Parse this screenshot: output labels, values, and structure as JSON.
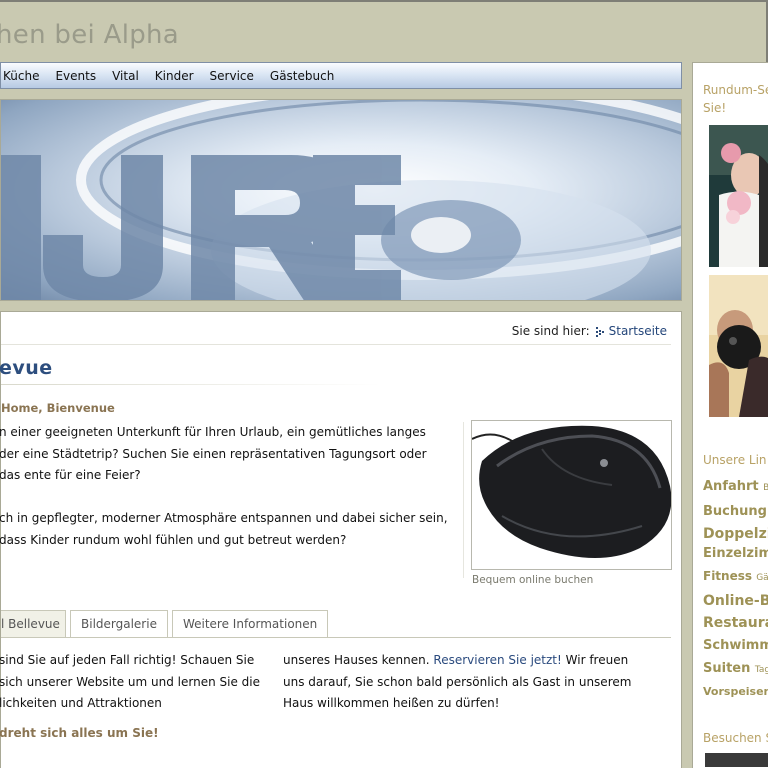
{
  "header": {
    "site_title": "hen bei Alpha"
  },
  "nav": {
    "items": [
      "Küche",
      "Events",
      "Vital",
      "Kinder",
      "Service",
      "Gästebuch"
    ]
  },
  "breadcrumb": {
    "label": "Sie sind hier:",
    "link": "Startseite"
  },
  "main": {
    "title": "evue",
    "subtitle": "Home, Bienvenue",
    "paragraph1": "n einer geeigneten Unterkunft für Ihren Urlaub, ein gemütliches langes der eine Städtetrip? Suchen Sie einen repräsentativen Tagungsort oder das ente für eine Feier?",
    "paragraph2": "ch in gepflegter, moderner Atmosphäre entspannen und dabei sicher sein, dass Kinder rundum wohl fühlen und gut betreut werden?",
    "image_caption": "Bequem online buchen",
    "tabs": [
      "l Bellevue",
      "Bildergalerie",
      "Weitere Informationen"
    ],
    "col_left": "sind Sie auf jeden Fall richtig! Schauen Sie sich unserer Website um und lernen Sie die lichkeiten und Attraktionen",
    "col_right_before": "unseres Hauses kennen. ",
    "col_right_link": "Reservieren Sie jetzt!",
    "col_right_after": " Wir freuen uns darauf, Sie schon bald persönlich als Gast in unserem Haus willkommen heißen zu dürfen!",
    "footer_note": "dreht sich alles um Sie!"
  },
  "sidebar": {
    "heading1_line1": "Rundum-Se",
    "heading1_line2": "Sie!",
    "heading2": "Unsere Lin",
    "links": [
      {
        "label": "Anfahrt",
        "small": "Ba",
        "size": "13px"
      },
      {
        "label": "Buchung O",
        "small": "",
        "size": "13px"
      },
      {
        "label": "Doppelzim",
        "small": "",
        "size": "14px"
      },
      {
        "label": "Einzelzimm",
        "small": "",
        "size": "13px"
      },
      {
        "label": "Fitness",
        "small": "Gäste",
        "size": "12px"
      },
      {
        "label": "Online-Bu",
        "small": "",
        "size": "14px"
      },
      {
        "label": "Restaura",
        "small": "",
        "size": "14px"
      },
      {
        "label": "Schwimmb",
        "small": "",
        "size": "13px"
      },
      {
        "label": "Suiten",
        "small": "Tag",
        "size": "13px"
      },
      {
        "label": "Vorspeisen",
        "small": "",
        "size": "11px"
      }
    ],
    "heading3": "Besuchen S"
  },
  "colors": {
    "background": "#c9c9b1",
    "nav_gradient_bottom": "#b7cae3",
    "title_blue": "#2d4e7e",
    "accent_olive": "#9e9256"
  },
  "icons": [
    "breadcrumb-arrow-icon"
  ]
}
